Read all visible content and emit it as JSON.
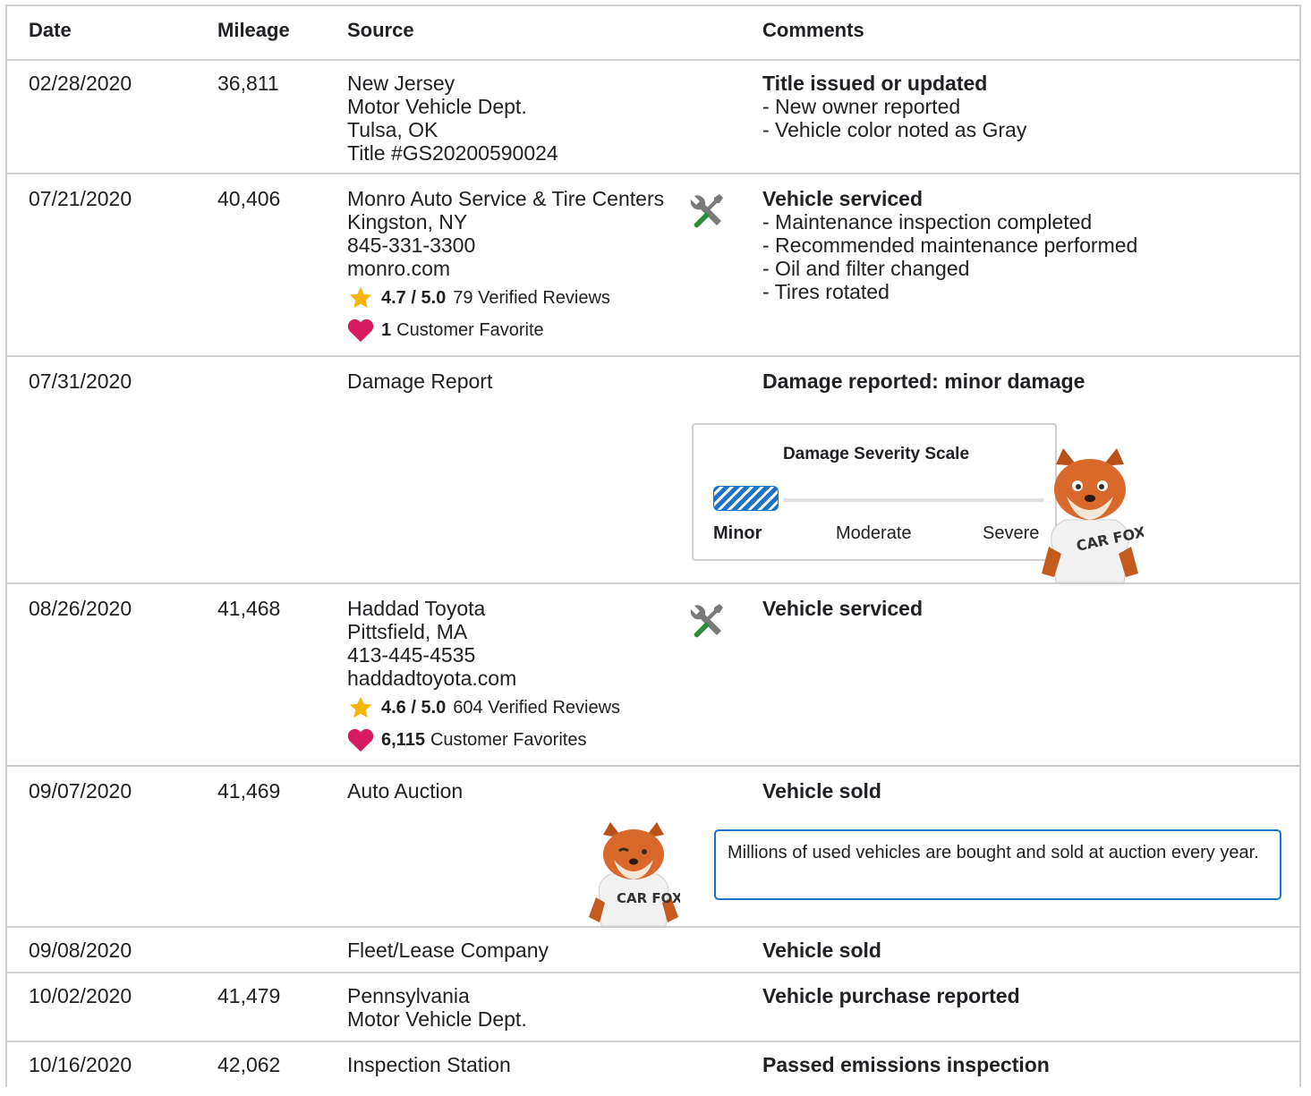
{
  "header": {
    "date": "Date",
    "mileage": "Mileage",
    "source": "Source",
    "comments": "Comments"
  },
  "rows": [
    {
      "date": "02/28/2020",
      "mileage": "36,811",
      "source": [
        "New Jersey",
        "Motor Vehicle Dept.",
        "Tulsa, OK",
        "Title #GS20200590024"
      ],
      "comment_title": "Title issued or updated",
      "comments": [
        "- New owner reported",
        "- Vehicle color noted as Gray"
      ]
    },
    {
      "date": "07/21/2020",
      "mileage": "40,406",
      "source": [
        "Monro Auto Service & Tire Centers",
        "Kingston, NY",
        "845-331-3300",
        "monro.com"
      ],
      "rating": "4.7 / 5.0",
      "reviews": "79 Verified Reviews",
      "favorites_count": "1",
      "favorites_label": "Customer Favorite",
      "icon": "service-tools-icon",
      "comment_title": "Vehicle serviced",
      "comments": [
        "- Maintenance inspection completed",
        "- Recommended maintenance performed",
        "- Oil and filter changed",
        "- Tires rotated"
      ]
    },
    {
      "date": "07/31/2020",
      "mileage": "",
      "source": [
        "Damage Report"
      ],
      "comment_title": "Damage reported: minor damage",
      "severity": {
        "title": "Damage Severity Scale",
        "levels": [
          "Minor",
          "Moderate",
          "Severe"
        ],
        "selected": "Minor"
      }
    },
    {
      "date": "08/26/2020",
      "mileage": "41,468",
      "source": [
        "Haddad Toyota",
        "Pittsfield, MA",
        "413-445-4535",
        "haddadtoyota.com"
      ],
      "rating": "4.6 / 5.0",
      "reviews": "604 Verified Reviews",
      "favorites_count": "6,115",
      "favorites_label": "Customer Favorites",
      "icon": "service-tools-icon",
      "comment_title": "Vehicle serviced"
    },
    {
      "date": "09/07/2020",
      "mileage": "41,469",
      "source": [
        "Auto Auction"
      ],
      "comment_title": "Vehicle sold",
      "notice": "Millions of used vehicles are bought and sold at auction every year."
    },
    {
      "date": "09/08/2020",
      "mileage": "",
      "source": [
        "Fleet/Lease Company"
      ],
      "comment_title": "Vehicle sold"
    },
    {
      "date": "10/02/2020",
      "mileage": "41,479",
      "source": [
        "Pennsylvania",
        "Motor Vehicle Dept."
      ],
      "comment_title": "Vehicle purchase reported"
    },
    {
      "date": "10/16/2020",
      "mileage": "42,062",
      "source": [
        "Inspection Station"
      ],
      "comment_title": "Passed emissions inspection"
    }
  ],
  "fox_shirt_text": "CAR FOX",
  "colors": {
    "border": "#cfcfcf",
    "accent_blue": "#1a73c9",
    "star": "#f7b500",
    "heart": "#d81b60",
    "tool_green": "#2e8b3a",
    "tool_gray": "#7a7a7a"
  }
}
